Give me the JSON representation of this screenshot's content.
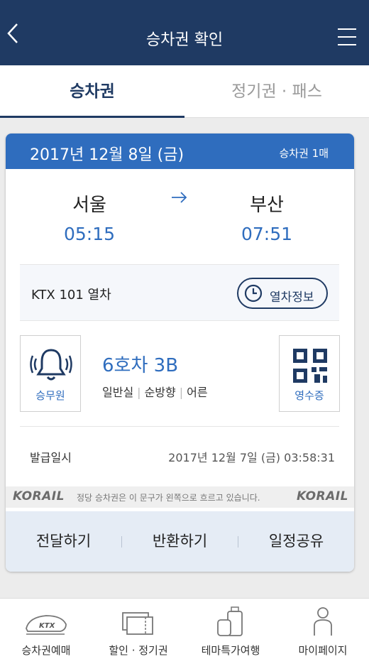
{
  "header": {
    "title": "승차권 확인"
  },
  "tabs": [
    {
      "label": "승차권"
    },
    {
      "label": "정기권 · 패스"
    }
  ],
  "ticket": {
    "date": "2017년 12월 8일 (금)",
    "count": "승차권 1매",
    "departure": {
      "station": "서울",
      "time": "05:15"
    },
    "arrival": {
      "station": "부산",
      "time": "07:51"
    },
    "train_name": "KTX 101 열차",
    "train_info_label": "열차정보",
    "crew_label": "승무원",
    "seat": "6호차 3B",
    "seat_class": "일반실",
    "seat_direction": "순방향",
    "passenger_type": "어른",
    "receipt_label": "영수증",
    "issue_label": "발급일시",
    "issue_value": "2017년 12월 7일 (금) 03:58:31",
    "korail_logo": "KORAIL",
    "notice": "정당 승차권은 이 문구가 왼쪽으로 흐르고 있습니다.",
    "actions": [
      "전달하기",
      "반환하기",
      "일정공유"
    ]
  },
  "bottom_nav": [
    {
      "label": "승차권예매",
      "icon": "ktx-train-icon"
    },
    {
      "label": "할인 · 정기권",
      "icon": "tickets-icon"
    },
    {
      "label": "테마특가여행",
      "icon": "luggage-icon"
    },
    {
      "label": "마이페이지",
      "icon": "person-icon"
    }
  ],
  "colors": {
    "header": "#1f3a63",
    "accent": "#2f6dbe",
    "actions_bg": "#e5ecf5"
  }
}
